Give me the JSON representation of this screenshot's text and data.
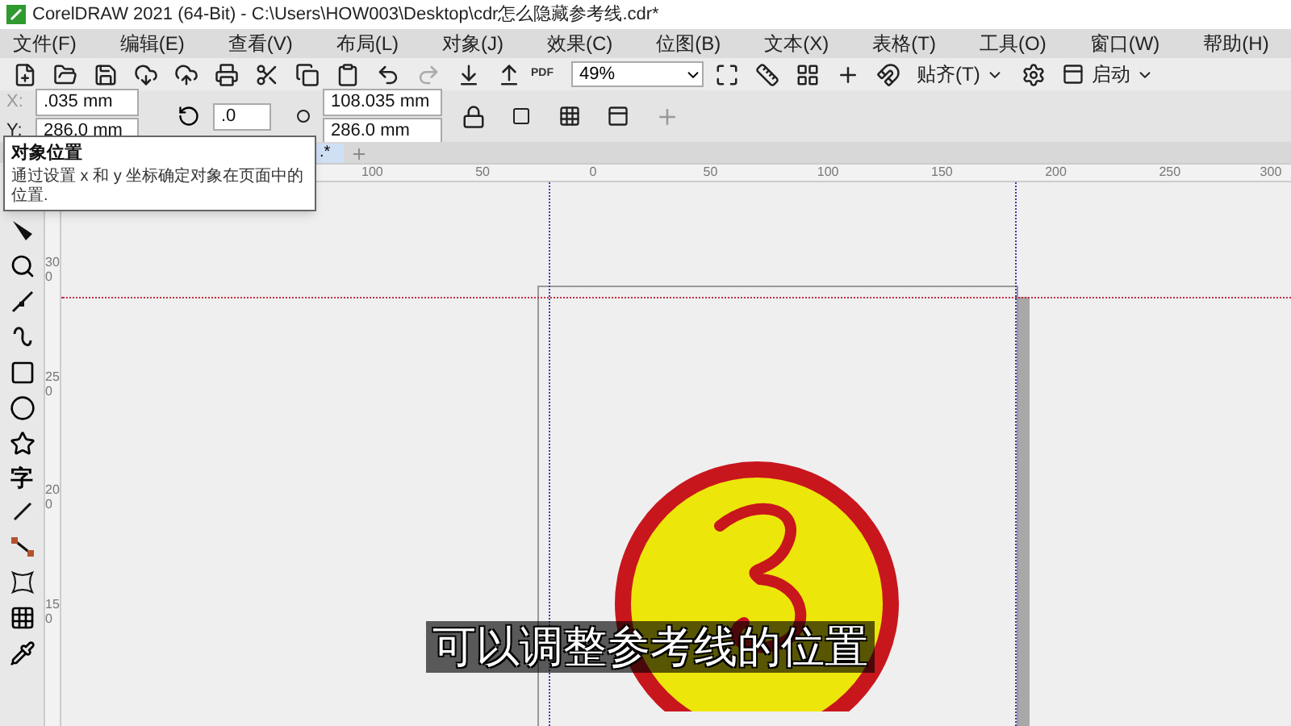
{
  "window": {
    "title": "CorelDRAW 2021 (64-Bit) - C:\\Users\\HOW003\\Desktop\\cdr怎么隐藏参考线.cdr*"
  },
  "menu": [
    "文件(F)",
    "编辑(E)",
    "查看(V)",
    "布局(L)",
    "对象(J)",
    "效果(C)",
    "位图(B)",
    "文本(X)",
    "表格(T)",
    "工具(O)",
    "窗口(W)",
    "帮助(H)"
  ],
  "toolbar": {
    "pdf_label": "PDF",
    "zoom": "49%",
    "snap": "贴齐(T)",
    "launch": "启动"
  },
  "property_bar": {
    "x_label": "X:",
    "x_value": ".035 mm",
    "y_label": "Y:",
    "y_value": "286.0 mm",
    "rotation": ".0",
    "width": "108.035 mm",
    "height": "286.0 mm"
  },
  "tooltip": {
    "title": "对象位置",
    "text": "通过设置 x 和 y 坐标确定对象在页面中的位置."
  },
  "document_tab": {
    "label": ".*",
    "selected": true
  },
  "horizontal_ruler": [
    "100",
    "50",
    "0",
    "50",
    "100",
    "150",
    "200",
    "250",
    "300"
  ],
  "vertical_ruler": [
    "300",
    "250",
    "200",
    "150"
  ],
  "toolbox": [
    {
      "kind": "shape"
    },
    {
      "kind": "zoom"
    },
    {
      "kind": "freehand"
    },
    {
      "kind": "curve"
    },
    {
      "kind": "rectangle"
    },
    {
      "kind": "ellipse"
    },
    {
      "kind": "star"
    },
    {
      "kind": "text",
      "glyph": "字"
    },
    {
      "kind": "line"
    },
    {
      "kind": "connector"
    },
    {
      "kind": "envelope"
    },
    {
      "kind": "pattern"
    },
    {
      "kind": "eyedropper"
    }
  ],
  "subtitle": "可以调整参考线的位置"
}
